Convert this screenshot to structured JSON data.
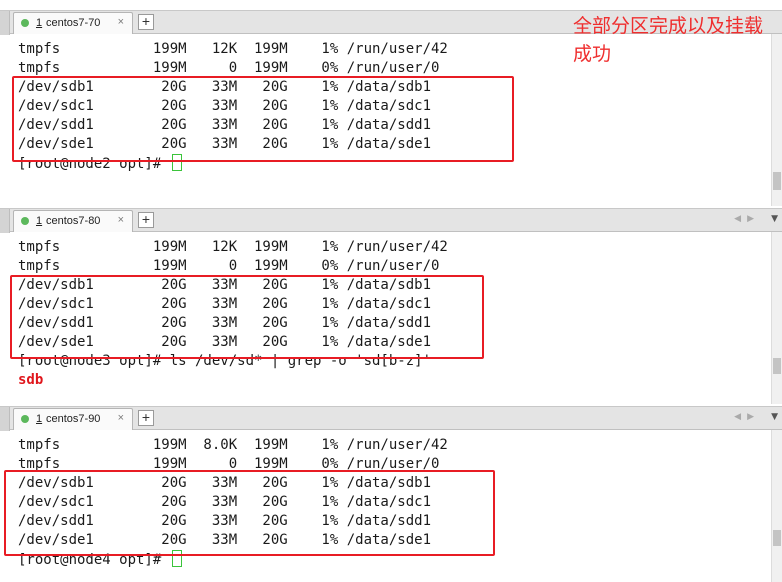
{
  "annotation": "全部分区完成以及挂载成功",
  "panes": [
    {
      "tab": {
        "index": "1",
        "name": "centos7-70",
        "close": "×"
      },
      "lines": [
        "tmpfs           199M   12K  199M    1% /run/user/42",
        "tmpfs           199M     0  199M    0% /run/user/0",
        "/dev/sdb1        20G   33M   20G    1% /data/sdb1",
        "/dev/sdc1        20G   33M   20G    1% /data/sdc1",
        "/dev/sdd1        20G   33M   20G    1% /data/sdd1",
        "/dev/sde1        20G   33M   20G    1% /data/sde1",
        "[root@node2 opt]# "
      ]
    },
    {
      "tab": {
        "index": "1",
        "name": "centos7-80",
        "close": "×"
      },
      "lines": [
        "tmpfs           199M   12K  199M    1% /run/user/42",
        "tmpfs           199M     0  199M    0% /run/user/0",
        "/dev/sdb1        20G   33M   20G    1% /data/sdb1",
        "/dev/sdc1        20G   33M   20G    1% /data/sdc1",
        "/dev/sdd1        20G   33M   20G    1% /data/sdd1",
        "/dev/sde1        20G   33M   20G    1% /data/sde1",
        "[root@node3 opt]# ls /dev/sd* | grep -o 'sd[b-z]'",
        "sdb"
      ]
    },
    {
      "tab": {
        "index": "1",
        "name": "centos7-90",
        "close": "×"
      },
      "lines": [
        "tmpfs           199M  8.0K  199M    1% /run/user/42",
        "tmpfs           199M     0  199M    0% /run/user/0",
        "/dev/sdb1        20G   33M   20G    1% /data/sdb1",
        "/dev/sdc1        20G   33M   20G    1% /data/sdc1",
        "/dev/sdd1        20G   33M   20G    1% /data/sdd1",
        "/dev/sde1        20G   33M   20G    1% /data/sde1",
        "[root@node4 opt]# "
      ]
    }
  ],
  "add_tab_label": "+",
  "colors": {
    "highlight": "#e81c24",
    "prompt_cursor": "#3bc43b",
    "output_red": "#e0161c"
  }
}
